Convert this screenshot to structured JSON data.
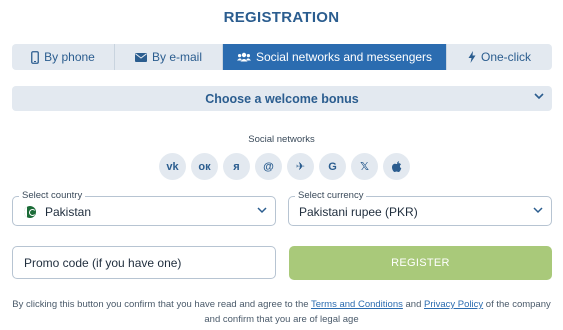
{
  "page": {
    "title": "REGISTRATION"
  },
  "tabs": [
    {
      "label": "By phone",
      "icon": "phone-icon"
    },
    {
      "label": "By e-mail",
      "icon": "envelope-icon"
    },
    {
      "label": "Social networks and messengers",
      "icon": "users-icon",
      "active": true
    },
    {
      "label": "One-click",
      "icon": "lightning-icon"
    }
  ],
  "bonus": {
    "label": "Choose a welcome bonus"
  },
  "social": {
    "label": "Social networks",
    "networks": [
      {
        "name": "vk",
        "glyph": "vk"
      },
      {
        "name": "odnoklassniki",
        "glyph": "ок"
      },
      {
        "name": "yandex",
        "glyph": "я"
      },
      {
        "name": "mail",
        "glyph": "@"
      },
      {
        "name": "telegram",
        "glyph": "✈"
      },
      {
        "name": "google",
        "glyph": "G"
      },
      {
        "name": "x",
        "glyph": "𝕏"
      },
      {
        "name": "apple",
        "glyph": ""
      }
    ]
  },
  "country": {
    "legend": "Select country",
    "value": "Pakistan"
  },
  "currency": {
    "legend": "Select currency",
    "value": "Pakistani rupee (PKR)"
  },
  "promo": {
    "placeholder": "Promo code (if you have one)"
  },
  "register": {
    "label": "REGISTER"
  },
  "terms": {
    "prefix": "By clicking this button you confirm that you have read and agree to the",
    "terms_link": "Terms and Conditions",
    "and": "and",
    "privacy_link": "Privacy Policy",
    "suffix": "of the company and confirm that you are of legal age"
  },
  "colors": {
    "accent": "#2b6cb0",
    "tab_bg": "#e3e9f0",
    "register_bg": "#a9c97a"
  }
}
